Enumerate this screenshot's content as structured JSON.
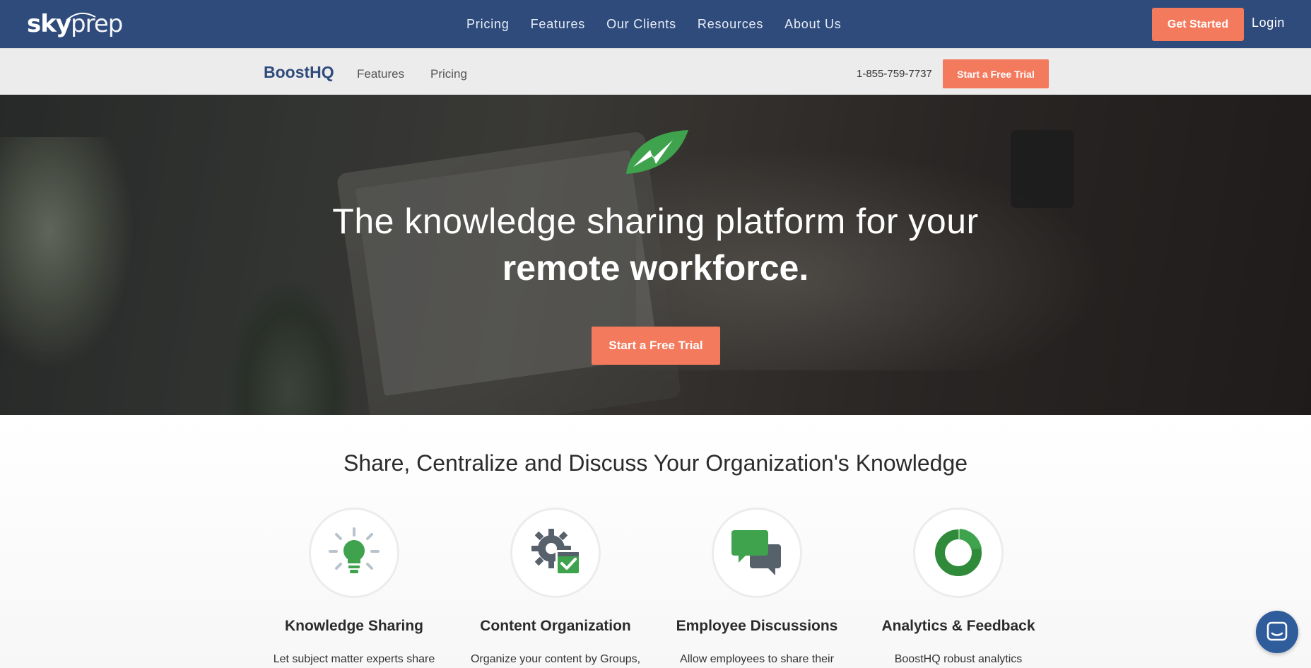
{
  "topnav": {
    "logo_sky": "sky",
    "logo_prep": "prep",
    "menu": [
      {
        "label": "Pricing"
      },
      {
        "label": "Features"
      },
      {
        "label": "Our Clients"
      },
      {
        "label": "Resources"
      },
      {
        "label": "About Us"
      }
    ],
    "get_started": "Get Started",
    "login": "Login"
  },
  "subnav": {
    "brand": "BoostHQ",
    "features": "Features",
    "pricing": "Pricing",
    "phone": "1-855-759-7737",
    "trial": "Start a Free Trial"
  },
  "hero": {
    "headline_line1": "The knowledge sharing platform for your",
    "headline_line2": "remote workforce.",
    "cta": "Start a Free Trial"
  },
  "section": {
    "title": "Share, Centralize and Discuss Your Organization's Knowledge",
    "features": [
      {
        "icon": "lightbulb-icon",
        "title": "Knowledge Sharing",
        "text": "Let subject matter experts share"
      },
      {
        "icon": "gear-check-icon",
        "title": "Content Organization",
        "text": "Organize your content by Groups,"
      },
      {
        "icon": "chat-bubbles-icon",
        "title": "Employee Discussions",
        "text": "Allow employees to share their"
      },
      {
        "icon": "donut-chart-icon",
        "title": "Analytics & Feedback",
        "text": "BoostHQ robust analytics"
      }
    ]
  },
  "colors": {
    "nav_blue": "#2f4b7c",
    "accent_orange": "#f47a5d",
    "icon_green": "#3fa34d",
    "icon_slate": "#56616c"
  }
}
